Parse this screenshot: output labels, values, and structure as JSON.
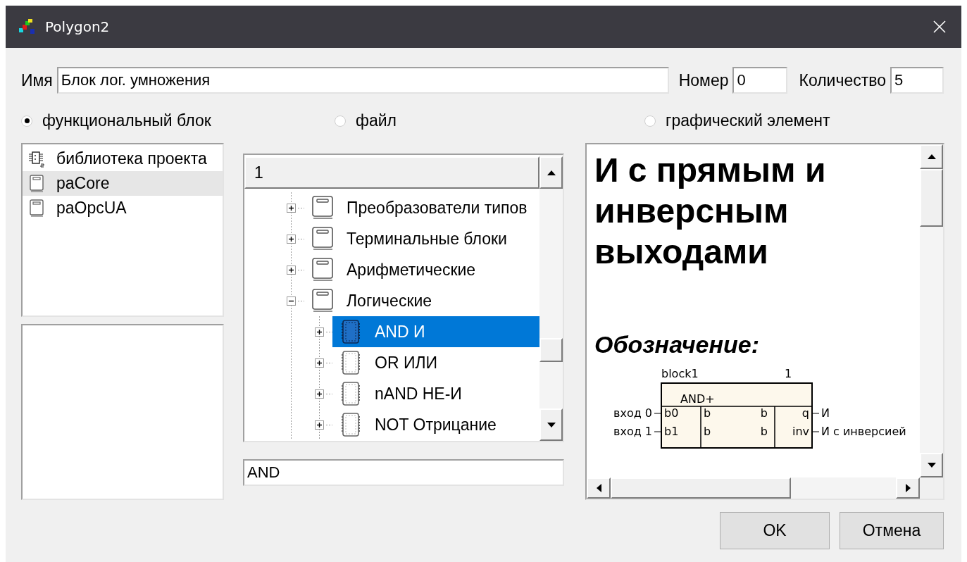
{
  "window": {
    "title": "Polygon2"
  },
  "fields": [
    {
      "label": "Имя",
      "value": "Блок лог. умножения"
    },
    {
      "label": "Номер",
      "value": "0"
    },
    {
      "label": "Количество",
      "value": "5"
    }
  ],
  "source_options": [
    {
      "label": "функциональный блок",
      "selected": true
    },
    {
      "label": "файл",
      "selected": false
    },
    {
      "label": "графический элемент",
      "selected": false
    }
  ],
  "libraries": [
    {
      "name": "библиотека проекта",
      "kind": "project",
      "selected": false
    },
    {
      "name": "paCore",
      "kind": "library",
      "selected": true
    },
    {
      "name": "paOpcUA",
      "kind": "library",
      "selected": false
    }
  ],
  "tree": {
    "header": "1",
    "items": [
      {
        "label": "Преобразователи типов",
        "kind": "folder",
        "expanded": false,
        "selected": false
      },
      {
        "label": "Терминальные блоки",
        "kind": "folder",
        "expanded": false,
        "selected": false
      },
      {
        "label": "Арифметические",
        "kind": "folder",
        "expanded": false,
        "selected": false
      },
      {
        "label": "Логические",
        "kind": "folder",
        "expanded": true,
        "selected": false,
        "children": [
          {
            "label": "AND И",
            "kind": "block",
            "expanded": false,
            "selected": true
          },
          {
            "label": "OR ИЛИ",
            "kind": "block",
            "expanded": false,
            "selected": false
          },
          {
            "label": "nAND НЕ-И",
            "kind": "block",
            "expanded": false,
            "selected": false
          },
          {
            "label": "NOT Отрицание",
            "kind": "block",
            "expanded": false,
            "selected": false
          }
        ]
      }
    ]
  },
  "search": {
    "value": "AND"
  },
  "help": {
    "title": "И с прямым и инверсным выходами",
    "subtitle": "Обозначение:",
    "diagram": {
      "instance": "block1",
      "number": "1",
      "type": "AND+",
      "inputs": [
        {
          "label": "вход 0",
          "pin": "b0",
          "type": "b"
        },
        {
          "label": "вход 1",
          "pin": "b1",
          "type": "b"
        }
      ],
      "outputs": [
        {
          "label": "И",
          "pin": "q",
          "type": "b"
        },
        {
          "label": "И с инверсией",
          "pin": "inv",
          "type": "b"
        }
      ]
    }
  },
  "buttons": [
    {
      "label": "OK"
    },
    {
      "label": "Отмена"
    }
  ]
}
